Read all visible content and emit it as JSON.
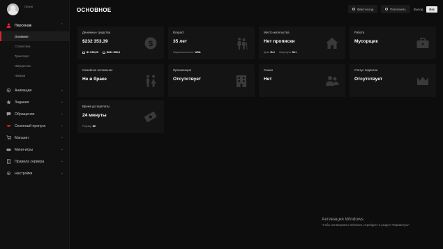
{
  "profile": {
    "username": "Логин"
  },
  "sidebar": {
    "sections": [
      {
        "label": "Персонаж",
        "icon": "person-icon",
        "active": true,
        "expanded": true,
        "children": [
          {
            "label": "Основное",
            "active": true
          },
          {
            "label": "Статистика"
          },
          {
            "label": "Транспорт"
          },
          {
            "label": "Имущество"
          },
          {
            "label": "Навыки"
          }
        ]
      },
      {
        "label": "Анимации",
        "icon": "animation-icon"
      },
      {
        "label": "Задания",
        "icon": "star-icon"
      },
      {
        "label": "Обращения",
        "icon": "chat-icon"
      },
      {
        "label": "Сезонный пропуск",
        "icon": "season-pass-icon"
      },
      {
        "label": "Магазин",
        "icon": "cart-icon"
      },
      {
        "label": "Мини-игры",
        "icon": "gamepad-icon"
      },
      {
        "label": "Правила сервера",
        "icon": "document-icon"
      },
      {
        "label": "Настройки",
        "icon": "settings-icon"
      }
    ]
  },
  "header": {
    "title": "ОСНОВНОЕ",
    "enter_code_label": "Ввести код",
    "topup_label": "Пополнить",
    "exit_label": "Выход",
    "esc_key": "Esc"
  },
  "cards": {
    "money": {
      "label": "Денежные средства",
      "value": "$232 353,39",
      "cash": "$1 045,09",
      "bank": "$231 308,3",
      "icon": "dollar-coin-icon"
    },
    "age": {
      "label": "Возраст",
      "value": "35 лет",
      "nationality_label": "Национальность:",
      "nationality": "USA",
      "icon": "elderly-couple-icon"
    },
    "residence": {
      "label": "Место жительства",
      "value": "Нет прописки",
      "house_label": "Дом:",
      "house": "Нет",
      "apartment_label": "Квартира:",
      "apartment": "Нет",
      "icon": "house-icon"
    },
    "job": {
      "label": "Работа",
      "value": "Мусорщик",
      "icon": "briefcase-icon"
    },
    "family_status": {
      "label": "Семейное положение",
      "value": "Не в браке",
      "icon": "couple-icon"
    },
    "organization": {
      "label": "Организация",
      "value": "Отсутствует",
      "icon": "building-icon"
    },
    "family": {
      "label": "Семья",
      "value": "Нет",
      "icon": "group-icon"
    },
    "subscription": {
      "label": "Статус подписки",
      "value": "Отсутствует",
      "icon": "crown-icon"
    },
    "salary": {
      "label": "Время до зарплаты",
      "value": "24 минуты",
      "payday_label": "Payday:",
      "payday": "$0",
      "icon": "money-bills-icon"
    }
  },
  "watermark": {
    "title": "Активация Windows",
    "subtitle": "Чтобы активировать Windows, перейдите в раздел \"Параметры\"."
  },
  "colors": {
    "accent": "#e2232b",
    "background": "#0d0d0d",
    "card": "#141414",
    "sidebar": "#111111",
    "icon": "#3a3a3a"
  }
}
